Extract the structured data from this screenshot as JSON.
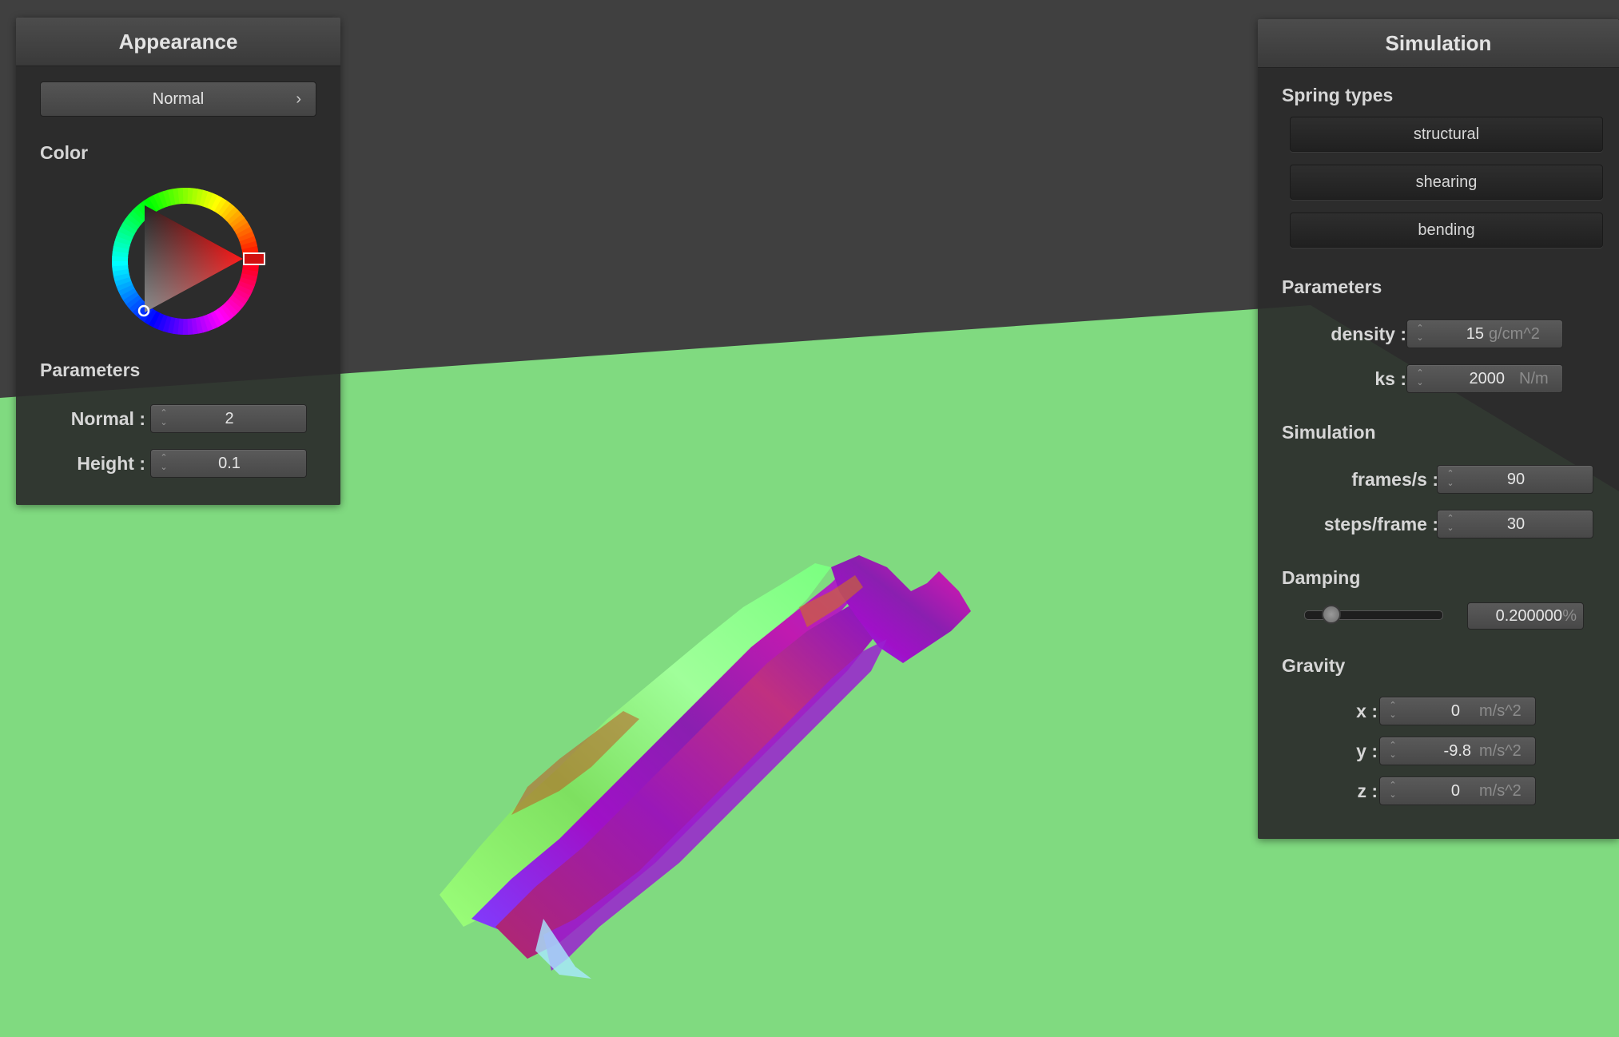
{
  "colors": {
    "ground": "#80da80",
    "sky": "#404040",
    "panel": "#2a2a2a"
  },
  "appearance": {
    "title": "Appearance",
    "shader_select": {
      "value": "Normal",
      "chevron": "›"
    },
    "color_label": "Color",
    "color_wheel_icon": "color-wheel-icon",
    "selected_hue": "#ff0000",
    "parameters_label": "Parameters",
    "normal": {
      "label": "Normal :",
      "value": "2"
    },
    "height": {
      "label": "Height :",
      "value": "0.1"
    }
  },
  "simulation_panel": {
    "title": "Simulation",
    "spring_types_label": "Spring types",
    "spring_buttons": [
      "structural",
      "shearing",
      "bending"
    ],
    "parameters_label": "Parameters",
    "density": {
      "label": "density :",
      "value": "15",
      "unit": "g/cm^2"
    },
    "ks": {
      "label": "ks :",
      "value": "2000",
      "unit": "N/m"
    },
    "simulation_label": "Simulation",
    "frames_per_s": {
      "label": "frames/s :",
      "value": "90"
    },
    "steps_per_frame": {
      "label": "steps/frame :",
      "value": "30"
    },
    "damping_label": "Damping",
    "damping": {
      "value": "0.200000",
      "unit": "%",
      "slider_fraction": 0.2
    },
    "gravity_label": "Gravity",
    "gravity_x": {
      "label": "x :",
      "value": "0",
      "unit": "m/s^2"
    },
    "gravity_y": {
      "label": "y :",
      "value": "-9.8",
      "unit": "m/s^2"
    },
    "gravity_z": {
      "label": "z :",
      "value": "0",
      "unit": "m/s^2"
    }
  }
}
